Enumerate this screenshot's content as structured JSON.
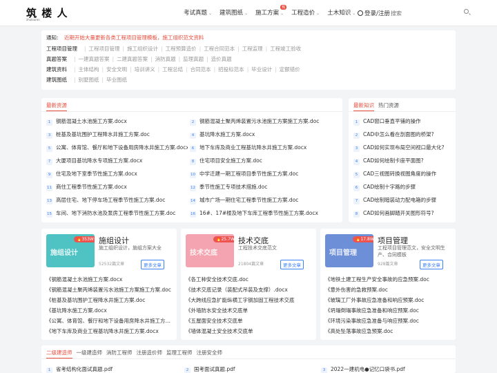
{
  "header": {
    "logo": "筑 楼 人",
    "logo_sub": "zhulouren",
    "nav": [
      {
        "label": "考试真题",
        "caret": "⌄"
      },
      {
        "label": "建筑图纸",
        "caret": "⌄"
      },
      {
        "label": "施工方案",
        "caret": "⌄",
        "badge": "热"
      },
      {
        "label": "工程造价",
        "caret": "⌄"
      },
      {
        "label": "土木知识",
        "caret": "⌄"
      }
    ],
    "login": "登录/注册",
    "search_placeholder": "搜索"
  },
  "notice": {
    "label": "通知:",
    "text": "近期开始大量更新各类工程项目管理模板，施工组织范文资料"
  },
  "categories": [
    {
      "label": "工程项目管理",
      "items": [
        "工程项目管理",
        "施工组织设计",
        "工程预算造价",
        "工程合同范本",
        "工程监理",
        "工程竣工验收"
      ]
    },
    {
      "label": "真题答案",
      "items": [
        "一建真题答案",
        "二建真题答案",
        "消防真题",
        "监理真题",
        "造价真题"
      ]
    },
    {
      "label": "建筑资料",
      "items": [
        "主体结构",
        "安全文明",
        "培训讲义",
        "工程总结",
        "合同范本",
        "招投标范本",
        "毕业设计",
        "定额错价"
      ]
    },
    {
      "label": "建筑图纸",
      "items": [
        "别墅图纸",
        "毕业图纸"
      ]
    }
  ],
  "latest": {
    "tab": "最新资源",
    "items": [
      "钢筋混凝土水池施工方案.docx",
      "钢筋混凝土聚丙烯装置污水池施工方案施工方案.doc",
      "桩基及基坑围护工程降水井施工方案.doc",
      "基坑降水施工方案.docx",
      "公寓、体育馆、餐厅和地下设备用房降水井施工方案.docx",
      "地下车库及商业工程基坑降水井施工方案.docx",
      "大厦项目基坑降水专项施工方案.docx",
      "住宅项目安全施工方案.doc",
      "住宅及地下室季节性施工方案.docx",
      "中学迁建一期工程项目季节性施工方案.doc",
      "商住工程季节性施工方案.docx",
      "季节性施工专项技术措施.doc",
      "高层住宅、地下停车场工程季节性施工方案.doc",
      "城市广场一期住宅工程季节性施工方案.doc",
      "车间、地下消防水池及泵房工程季节性施工方案.doc",
      "16#、17#楼及地下车库工程季节性施工方案.docx"
    ]
  },
  "knowledge": {
    "tab_active": "最新知识",
    "tab": "热门资源",
    "items": [
      "CAD窗口垂直平铺的操作",
      "CAD中怎么看在剖面图的桥架?",
      "CAD如何实现布局空间视口最大化?",
      "CAD如何绘制卡座平面图?",
      "CAD三视图转换视图角度的操作",
      "CAD绘制十字路的步骤",
      "CAD绘制暗装动力配电箱的步骤",
      "CAD如何画脚踏开关图形符号?"
    ]
  },
  "features": [
    {
      "title": "施组设计",
      "thumb_label": "施组设计",
      "tag": "🔥353W+",
      "desc": "施工组织设计，施组方案大全",
      "count": "52532篇文章",
      "more": "更多文章",
      "color": "#4fc3c3",
      "items": [
        "《钢筋混凝土水池施工方案.docx",
        "《钢筋混凝土聚丙烯装置污水池施工方案施工方案.doc",
        "《桩基及基坑围护工程降水井施工方案.doc",
        "《基坑降水施工方案.docx",
        "《公寓、体育馆、餐厅和地下设备用房降水井施工方案.docx",
        "《地下车库及商业工程基坑降水井施工方案.docx"
      ]
    },
    {
      "title": "技术交底",
      "thumb_label": "技术交底",
      "tag": "🔥25.7W+",
      "desc": "工程技术交底范文",
      "count": "21804篇文章",
      "more": "更多文章",
      "color": "#f4a3b0",
      "items": [
        "《各工种安全技术交底.doc",
        "《技术交底记录（装配式吊装及支撑）.docx",
        "《大跨线应急扩能纵横工字钢加固工程技术交底",
        "《外墙防水安全技术交底单",
        "《五屋面安全技术交底单",
        "《墙体混凝土安全技术交底单"
      ]
    },
    {
      "title": "项目管理",
      "thumb_label": "项目管理",
      "tag": "🔥17.8W+",
      "desc": "工程项目管理范文，安全文明生产、合同模板",
      "count": "928篇文章",
      "more": "更多文章",
      "color": "#6d8fd8",
      "items": [
        "《地铁土建工程生产安全事故的应急预案.doc",
        "《意外伤害的急救预案.doc",
        "《玻璃工厂外事故应急准备和响应预案.doc",
        "《坍塌倒塌事故应急准备和响应预案.doc",
        "《环境污染事故应急准备与响应预案.doc",
        "《高处坠落事故应急预案.doc"
      ]
    }
  ],
  "exams": {
    "tab_active": "二级建造师",
    "tabs": [
      "一级建造师",
      "消防工程师",
      "注册造价师",
      "监理工程师",
      "注册安全师"
    ],
    "items": [
      {
        "num": "1",
        "text": "省考结构化面试真题.pdf"
      },
      {
        "num": "2",
        "text": "国考面试真题.pdf"
      },
      {
        "num": "3",
        "text": "2022一建机电●记忆口袋书.pdf"
      }
    ]
  }
}
